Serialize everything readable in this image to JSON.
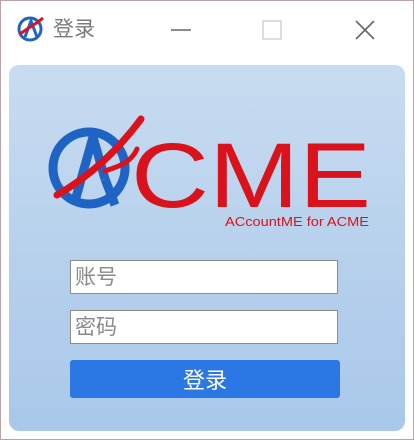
{
  "window": {
    "title": "登录",
    "app_icon": "acme-logo-icon",
    "controls": {
      "minimize_icon": "minimize-icon",
      "maximize_icon": "maximize-icon",
      "close_icon": "close-icon"
    }
  },
  "logo": {
    "brand": "CME",
    "tagline": "ACcountME for ACME",
    "colors": {
      "red": "#d9121c",
      "blue": "#1f63c4"
    }
  },
  "form": {
    "username": {
      "placeholder": "账号",
      "value": ""
    },
    "password": {
      "placeholder": "密码",
      "value": ""
    },
    "submit_label": "登录"
  },
  "colors": {
    "button": "#2b78e4",
    "panel_top": "#c8dcf1",
    "panel_bottom": "#a9c8ea"
  }
}
